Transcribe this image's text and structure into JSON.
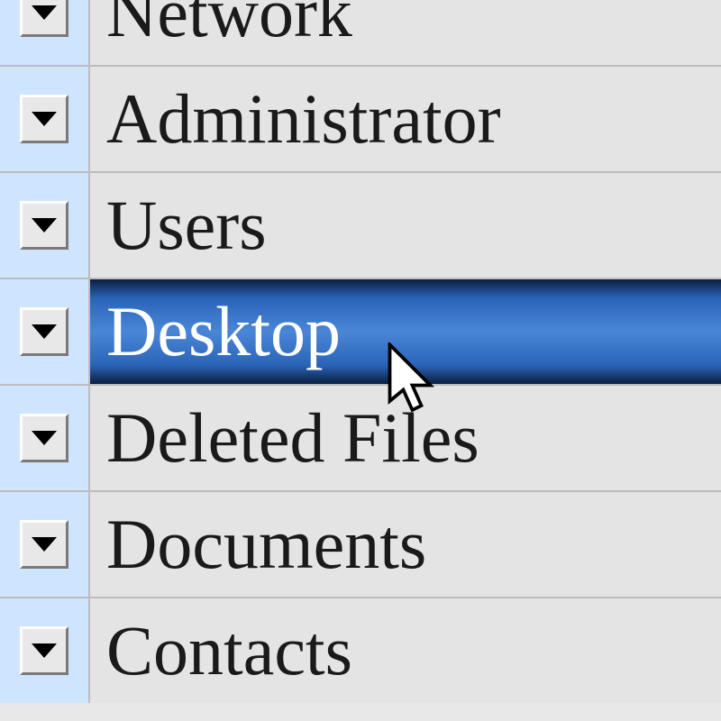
{
  "items": [
    {
      "label": "Network",
      "selected": false
    },
    {
      "label": "Administrator",
      "selected": false
    },
    {
      "label": "Users",
      "selected": false
    },
    {
      "label": "Desktop",
      "selected": true
    },
    {
      "label": "Deleted Files",
      "selected": false
    },
    {
      "label": "Documents",
      "selected": false
    },
    {
      "label": "Contacts",
      "selected": false
    }
  ]
}
